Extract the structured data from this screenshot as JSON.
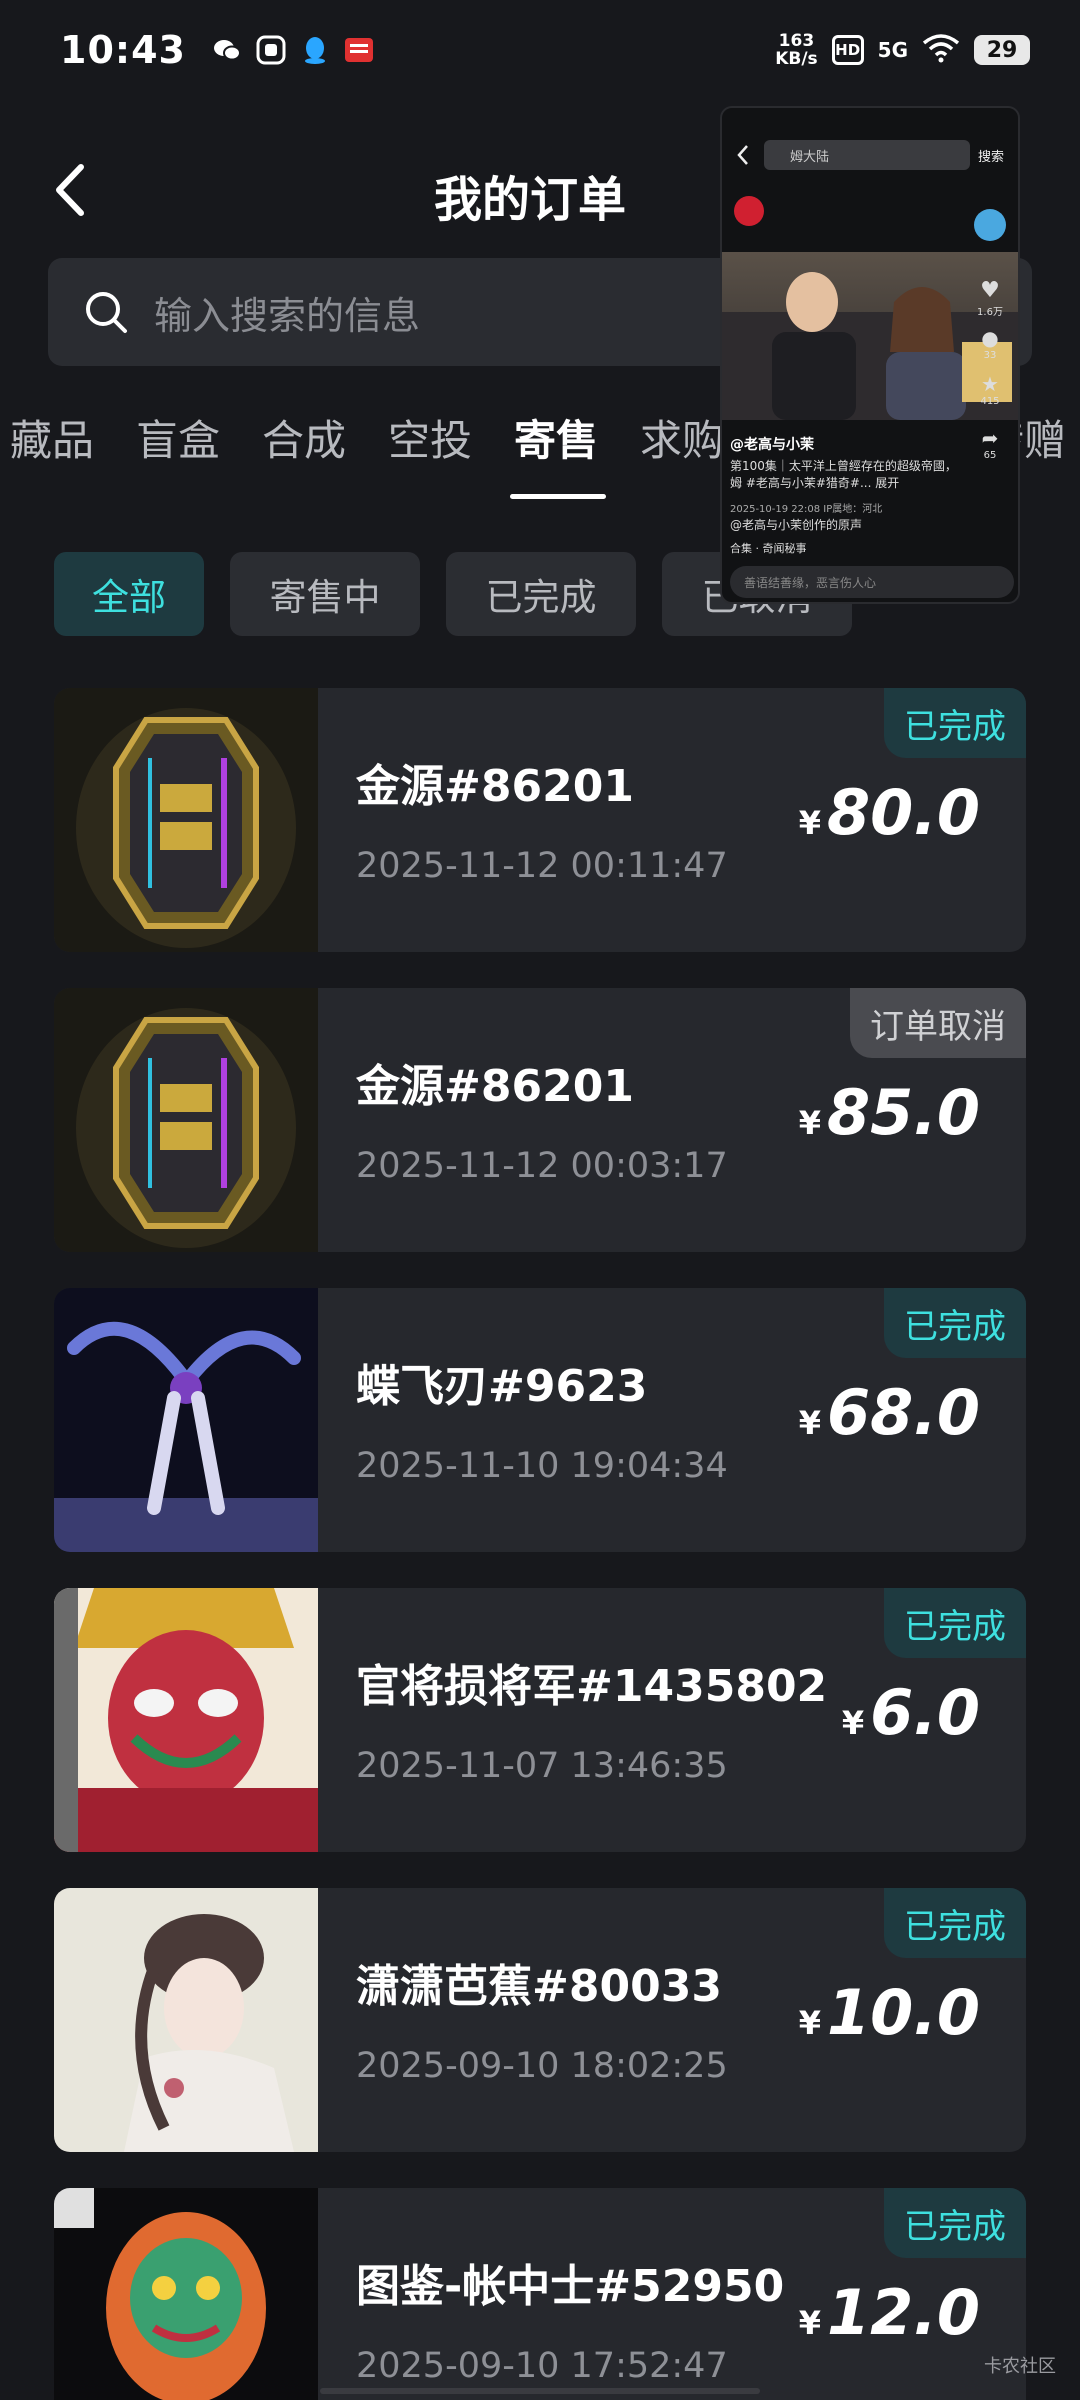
{
  "status_bar": {
    "time": "10:43",
    "net_speed_value": "163",
    "net_speed_unit": "KB/s",
    "hd": "HD",
    "network": "5G",
    "battery": "29"
  },
  "header": {
    "title": "我的订单"
  },
  "search": {
    "placeholder": "输入搜索的信息"
  },
  "tabs": [
    {
      "label": "藏品"
    },
    {
      "label": "盲盒"
    },
    {
      "label": "合成"
    },
    {
      "label": "空投"
    },
    {
      "label": "寄售",
      "active": true
    },
    {
      "label": "求购"
    },
    {
      "label": "转赠"
    }
  ],
  "filters": [
    {
      "label": "全部",
      "active": true
    },
    {
      "label": "寄售中"
    },
    {
      "label": "已完成"
    },
    {
      "label": "已取消"
    }
  ],
  "orders": [
    {
      "name": "金源#86201",
      "time": "2025-11-12 00:11:47",
      "currency": "¥",
      "price": "80.0",
      "status": "已完成"
    },
    {
      "name": "金源#86201",
      "time": "2025-11-12 00:03:17",
      "currency": "¥",
      "price": "85.0",
      "status": "订单取消"
    },
    {
      "name": "蝶飞刃#9623",
      "time": "2025-11-10 19:04:34",
      "currency": "¥",
      "price": "68.0",
      "status": "已完成"
    },
    {
      "name": "官将损将军#1435802",
      "time": "2025-11-07 13:46:35",
      "currency": "¥",
      "price": "6.0",
      "status": "已完成"
    },
    {
      "name": "潇潇芭蕉#80033",
      "time": "2025-09-10 18:02:25",
      "currency": "¥",
      "price": "10.0",
      "status": "已完成"
    },
    {
      "name": "图鉴-帐中士#52950",
      "time": "2025-09-10 17:52:47",
      "currency": "¥",
      "price": "12.0",
      "status": "已完成"
    }
  ],
  "floating_window": {
    "search_text": "姆大陆",
    "search_button": "搜索",
    "author": "@老高与小茉",
    "description": "第100集｜太平洋上曾經存在的超级帝國，姆 #老高与小茉#猎奇#... 展开",
    "meta": "2025-10-19 22:08 IP属地：河北",
    "music": "@老高与小茉创作的原声",
    "collection": "合集 · 奇闻秘事",
    "comment_placeholder": "善语结善缘，恶言伤人心",
    "likes": "1.6万",
    "comments": "33",
    "favorites": "415",
    "shares": "65"
  },
  "watermark": "卡农社区",
  "colors": {
    "accent": "#3ee0df",
    "background": "#17181c",
    "card": "#26282d"
  }
}
